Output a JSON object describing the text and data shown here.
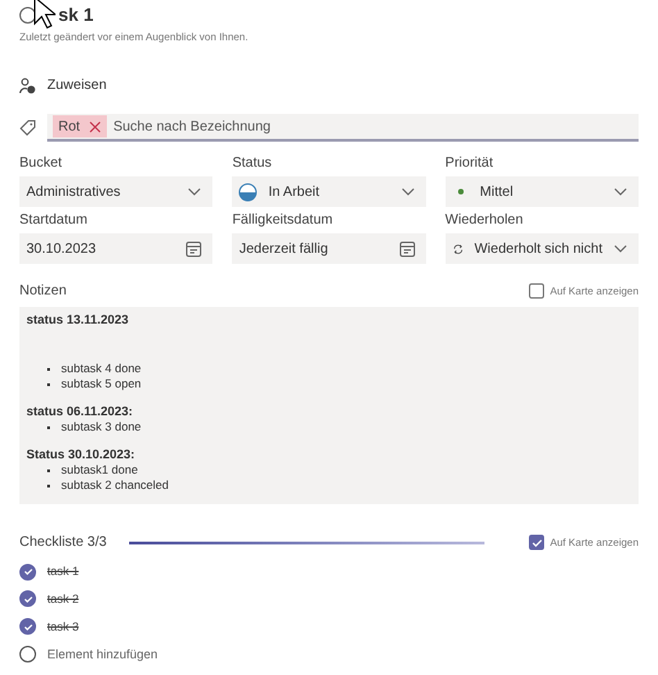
{
  "task": {
    "title": "sk 1",
    "completed": false,
    "modified": "Zuletzt geändert vor einem Augenblick von Ihnen."
  },
  "assign": {
    "label": "Zuweisen"
  },
  "labels": {
    "tags": [
      {
        "text": "Rot",
        "color": "#f4c7cc"
      }
    ],
    "placeholder": "Suche nach Bezeichnung"
  },
  "fields": [
    {
      "label": "Bucket",
      "value": "Administratives",
      "kind": "dropdown"
    },
    {
      "label": "Status",
      "value": "In Arbeit",
      "kind": "status"
    },
    {
      "label": "Priorität",
      "value": "Mittel",
      "kind": "priority"
    },
    {
      "label": "Startdatum",
      "value": "30.10.2023",
      "kind": "date"
    },
    {
      "label": "Fälligkeitsdatum",
      "value": "Jederzeit fällig",
      "kind": "date"
    },
    {
      "label": "Wiederholen",
      "value": "Wiederholt sich nicht",
      "kind": "repeat"
    }
  ],
  "notes": {
    "label": "Notizen",
    "show_on_card": {
      "label": "Auf Karte anzeigen",
      "checked": false
    },
    "blocks": [
      {
        "heading": "status 13.11.2023",
        "gap": true,
        "items": [
          "subtask 4 done",
          "subtask 5 open"
        ]
      },
      {
        "heading": "status 06.11.2023:",
        "gap": false,
        "items": [
          "subtask 3 done"
        ]
      },
      {
        "heading": "Status 30.10.2023:",
        "gap": false,
        "items": [
          "subtask1 done",
          "subtask 2 chanceled"
        ]
      }
    ]
  },
  "checklist": {
    "label": "Checkliste 3/3",
    "level": 1,
    "show_on_card": {
      "label": "Auf Karte anzeigen",
      "checked": true
    },
    "items": [
      {
        "text": "task 1",
        "checked": true
      },
      {
        "text": "task 2",
        "checked": true
      },
      {
        "text": "task 3",
        "checked": true
      }
    ],
    "add_placeholder": "Element hinzufügen"
  }
}
